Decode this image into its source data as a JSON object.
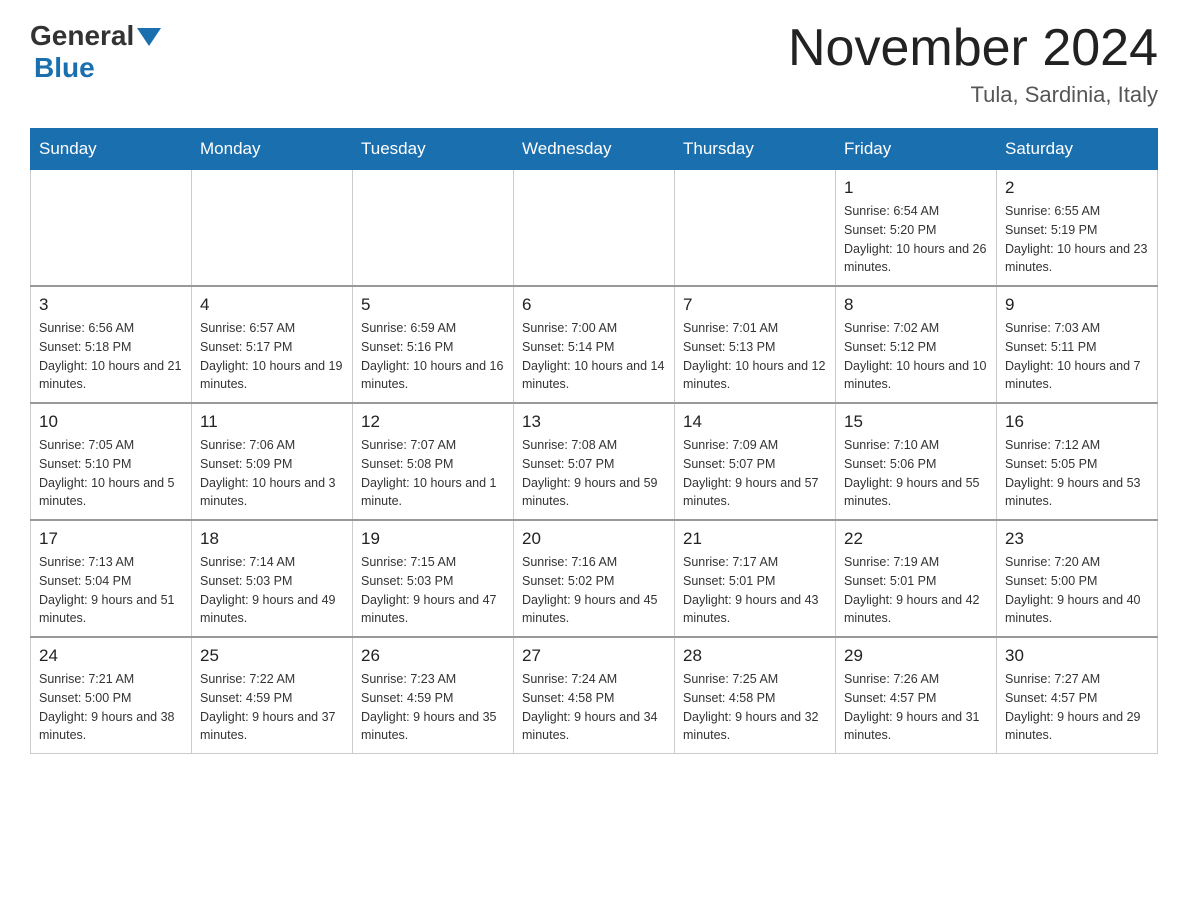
{
  "header": {
    "logo_general": "General",
    "logo_blue": "Blue",
    "title": "November 2024",
    "subtitle": "Tula, Sardinia, Italy"
  },
  "days_of_week": [
    "Sunday",
    "Monday",
    "Tuesday",
    "Wednesday",
    "Thursday",
    "Friday",
    "Saturday"
  ],
  "weeks": [
    [
      {
        "day": "",
        "info": ""
      },
      {
        "day": "",
        "info": ""
      },
      {
        "day": "",
        "info": ""
      },
      {
        "day": "",
        "info": ""
      },
      {
        "day": "",
        "info": ""
      },
      {
        "day": "1",
        "info": "Sunrise: 6:54 AM\nSunset: 5:20 PM\nDaylight: 10 hours and 26 minutes."
      },
      {
        "day": "2",
        "info": "Sunrise: 6:55 AM\nSunset: 5:19 PM\nDaylight: 10 hours and 23 minutes."
      }
    ],
    [
      {
        "day": "3",
        "info": "Sunrise: 6:56 AM\nSunset: 5:18 PM\nDaylight: 10 hours and 21 minutes."
      },
      {
        "day": "4",
        "info": "Sunrise: 6:57 AM\nSunset: 5:17 PM\nDaylight: 10 hours and 19 minutes."
      },
      {
        "day": "5",
        "info": "Sunrise: 6:59 AM\nSunset: 5:16 PM\nDaylight: 10 hours and 16 minutes."
      },
      {
        "day": "6",
        "info": "Sunrise: 7:00 AM\nSunset: 5:14 PM\nDaylight: 10 hours and 14 minutes."
      },
      {
        "day": "7",
        "info": "Sunrise: 7:01 AM\nSunset: 5:13 PM\nDaylight: 10 hours and 12 minutes."
      },
      {
        "day": "8",
        "info": "Sunrise: 7:02 AM\nSunset: 5:12 PM\nDaylight: 10 hours and 10 minutes."
      },
      {
        "day": "9",
        "info": "Sunrise: 7:03 AM\nSunset: 5:11 PM\nDaylight: 10 hours and 7 minutes."
      }
    ],
    [
      {
        "day": "10",
        "info": "Sunrise: 7:05 AM\nSunset: 5:10 PM\nDaylight: 10 hours and 5 minutes."
      },
      {
        "day": "11",
        "info": "Sunrise: 7:06 AM\nSunset: 5:09 PM\nDaylight: 10 hours and 3 minutes."
      },
      {
        "day": "12",
        "info": "Sunrise: 7:07 AM\nSunset: 5:08 PM\nDaylight: 10 hours and 1 minute."
      },
      {
        "day": "13",
        "info": "Sunrise: 7:08 AM\nSunset: 5:07 PM\nDaylight: 9 hours and 59 minutes."
      },
      {
        "day": "14",
        "info": "Sunrise: 7:09 AM\nSunset: 5:07 PM\nDaylight: 9 hours and 57 minutes."
      },
      {
        "day": "15",
        "info": "Sunrise: 7:10 AM\nSunset: 5:06 PM\nDaylight: 9 hours and 55 minutes."
      },
      {
        "day": "16",
        "info": "Sunrise: 7:12 AM\nSunset: 5:05 PM\nDaylight: 9 hours and 53 minutes."
      }
    ],
    [
      {
        "day": "17",
        "info": "Sunrise: 7:13 AM\nSunset: 5:04 PM\nDaylight: 9 hours and 51 minutes."
      },
      {
        "day": "18",
        "info": "Sunrise: 7:14 AM\nSunset: 5:03 PM\nDaylight: 9 hours and 49 minutes."
      },
      {
        "day": "19",
        "info": "Sunrise: 7:15 AM\nSunset: 5:03 PM\nDaylight: 9 hours and 47 minutes."
      },
      {
        "day": "20",
        "info": "Sunrise: 7:16 AM\nSunset: 5:02 PM\nDaylight: 9 hours and 45 minutes."
      },
      {
        "day": "21",
        "info": "Sunrise: 7:17 AM\nSunset: 5:01 PM\nDaylight: 9 hours and 43 minutes."
      },
      {
        "day": "22",
        "info": "Sunrise: 7:19 AM\nSunset: 5:01 PM\nDaylight: 9 hours and 42 minutes."
      },
      {
        "day": "23",
        "info": "Sunrise: 7:20 AM\nSunset: 5:00 PM\nDaylight: 9 hours and 40 minutes."
      }
    ],
    [
      {
        "day": "24",
        "info": "Sunrise: 7:21 AM\nSunset: 5:00 PM\nDaylight: 9 hours and 38 minutes."
      },
      {
        "day": "25",
        "info": "Sunrise: 7:22 AM\nSunset: 4:59 PM\nDaylight: 9 hours and 37 minutes."
      },
      {
        "day": "26",
        "info": "Sunrise: 7:23 AM\nSunset: 4:59 PM\nDaylight: 9 hours and 35 minutes."
      },
      {
        "day": "27",
        "info": "Sunrise: 7:24 AM\nSunset: 4:58 PM\nDaylight: 9 hours and 34 minutes."
      },
      {
        "day": "28",
        "info": "Sunrise: 7:25 AM\nSunset: 4:58 PM\nDaylight: 9 hours and 32 minutes."
      },
      {
        "day": "29",
        "info": "Sunrise: 7:26 AM\nSunset: 4:57 PM\nDaylight: 9 hours and 31 minutes."
      },
      {
        "day": "30",
        "info": "Sunrise: 7:27 AM\nSunset: 4:57 PM\nDaylight: 9 hours and 29 minutes."
      }
    ]
  ]
}
